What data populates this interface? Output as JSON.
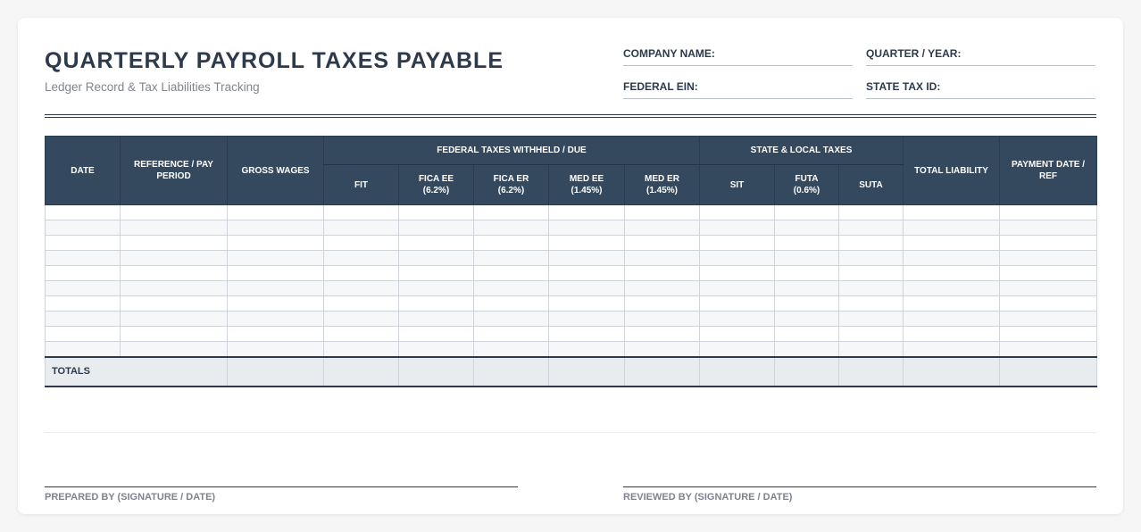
{
  "header": {
    "title": "QUARTERLY PAYROLL TAXES PAYABLE",
    "subtitle": "Ledger Record & Tax Liabilities Tracking"
  },
  "fields": {
    "company_name": "COMPANY NAME:",
    "quarter_year": "QUARTER / YEAR:",
    "federal_ein": "FEDERAL EIN:",
    "state_tax_id": "STATE TAX ID:"
  },
  "table": {
    "columns": {
      "date": "DATE",
      "reference": "REFERENCE / PAY PERIOD",
      "gross_wages": "GROSS WAGES",
      "federal_group": "FEDERAL TAXES WITHHELD / DUE",
      "fit": "FIT",
      "fica_ee": "FICA EE",
      "fica_ee_rate": "(6.2%)",
      "fica_er": "FICA ER",
      "fica_er_rate": "(6.2%)",
      "med_ee": "MED EE",
      "med_ee_rate": "(1.45%)",
      "med_er": "MED ER",
      "med_er_rate": "(1.45%)",
      "state_group": "STATE & LOCAL TAXES",
      "sit": "SIT",
      "futa": "FUTA",
      "futa_rate": "(0.6%)",
      "suta": "SUTA",
      "total_liability": "TOTAL LIABILITY",
      "payment_date": "PAYMENT DATE / REF"
    },
    "blank_rows": 10,
    "totals_label": "TOTALS"
  },
  "signatures": {
    "prepared_by": "PREPARED BY (SIGNATURE / DATE)",
    "reviewed_by": "REVIEWED BY (SIGNATURE / DATE)"
  },
  "colors": {
    "header_bg": "#34495e",
    "text_dark": "#2c3a4b",
    "text_muted": "#7c858f",
    "totals_bg": "#e9ecef"
  }
}
